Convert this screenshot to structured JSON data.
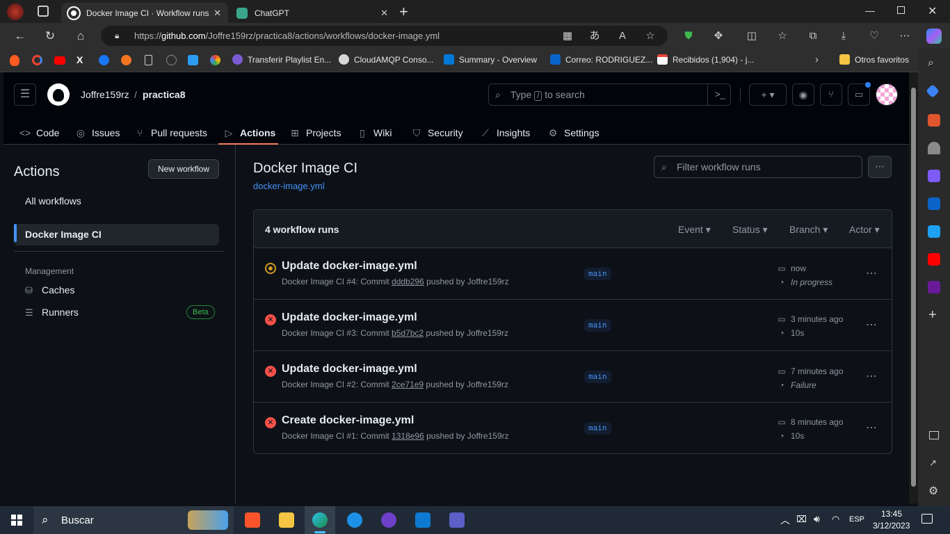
{
  "browser": {
    "tabs": [
      {
        "label": "Docker Image CI · Workflow runs",
        "active": true
      },
      {
        "label": "ChatGPT",
        "active": false
      }
    ],
    "url_prefix": "https://",
    "url_host": "github.com",
    "url_path": "/Joffre159rz/practica8/actions/workflows/docker-image.yml",
    "favorites": [
      "Transferir Playlist En...",
      "CloudAMQP Conso...",
      "Summary - Overview",
      "Correo: RODRIGUEZ...",
      "Recibidos (1,904) - j..."
    ],
    "other_favorites": "Otros favoritos"
  },
  "header": {
    "owner": "Joffre159rz",
    "separator": "/",
    "repo": "practica8",
    "search_pre": "Type ",
    "search_key": "/",
    "search_post": " to search",
    "plus": "+ ▾"
  },
  "reponav": {
    "items": [
      {
        "label": "Code",
        "icon": "code-icon"
      },
      {
        "label": "Issues",
        "icon": "issue-icon"
      },
      {
        "label": "Pull requests",
        "icon": "pull-request-icon"
      },
      {
        "label": "Actions",
        "icon": "play-icon",
        "selected": true
      },
      {
        "label": "Projects",
        "icon": "table-icon"
      },
      {
        "label": "Wiki",
        "icon": "book-icon"
      },
      {
        "label": "Security",
        "icon": "shield-icon"
      },
      {
        "label": "Insights",
        "icon": "graph-icon"
      },
      {
        "label": "Settings",
        "icon": "gear-icon"
      }
    ]
  },
  "sidebar": {
    "title": "Actions",
    "new_workflow": "New workflow",
    "all_workflows": "All workflows",
    "selected_workflow": "Docker Image CI",
    "management_label": "Management",
    "caches": "Caches",
    "runners": "Runners",
    "beta": "Beta"
  },
  "main": {
    "title": "Docker Image CI",
    "file_link": "docker-image.yml",
    "filter_placeholder": "Filter workflow runs",
    "runs_count": "4 workflow runs",
    "filters": [
      "Event ▾",
      "Status ▾",
      "Branch ▾",
      "Actor ▾"
    ],
    "runs": [
      {
        "status": "in-progress",
        "title": "Update docker-image.yml",
        "meta_pre": "Docker Image CI #4: Commit ",
        "commit": "dddb296",
        "meta_post": " pushed by Joffre159rz",
        "branch": "main",
        "time": "now",
        "duration": "In progress",
        "duration_italic": true
      },
      {
        "status": "failure",
        "title": "Update docker-image.yml",
        "meta_pre": "Docker Image CI #3: Commit ",
        "commit": "b5d7bc2",
        "meta_post": " pushed by Joffre159rz",
        "branch": "main",
        "time": "3 minutes ago",
        "duration": "10s",
        "duration_italic": false
      },
      {
        "status": "failure",
        "title": "Update docker-image.yml",
        "meta_pre": "Docker Image CI #2: Commit ",
        "commit": "2ce71e9",
        "meta_post": " pushed by Joffre159rz",
        "branch": "main",
        "time": "7 minutes ago",
        "duration": "Failure",
        "duration_italic": true
      },
      {
        "status": "failure",
        "title": "Create docker-image.yml",
        "meta_pre": "Docker Image CI #1: Commit ",
        "commit": "1318e96",
        "meta_post": " pushed by Joffre159rz",
        "branch": "main",
        "time": "8 minutes ago",
        "duration": "10s",
        "duration_italic": false
      }
    ]
  },
  "taskbar": {
    "search": "Buscar",
    "lang": "ESP",
    "time": "13:45",
    "date": "3/12/2023"
  },
  "colors": {
    "accent": "#f78166",
    "link": "#4493f8",
    "failure": "#f85149",
    "in_progress": "#d29922",
    "beta": "#3fb950"
  }
}
